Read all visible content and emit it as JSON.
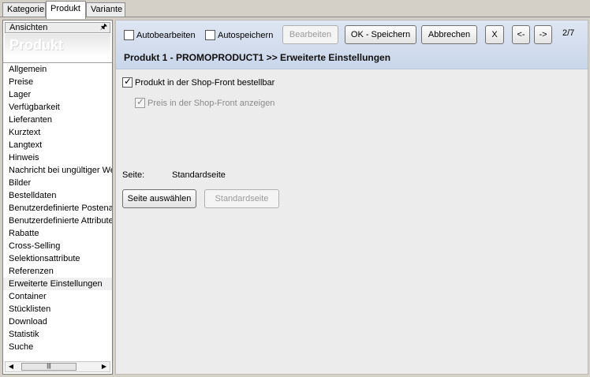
{
  "tabs": [
    {
      "label": "Kategorie"
    },
    {
      "label": "Produkt"
    },
    {
      "label": "Variante"
    }
  ],
  "left_panel": {
    "header": "Ansichten",
    "banner": "Produkt",
    "items": [
      {
        "label": "Allgemein"
      },
      {
        "label": "Preise"
      },
      {
        "label": "Lager"
      },
      {
        "label": "Verfügbarkeit"
      },
      {
        "label": "Lieferanten"
      },
      {
        "label": "Kurztext"
      },
      {
        "label": "Langtext"
      },
      {
        "label": "Hinweis"
      },
      {
        "label": "Nachricht bei ungültiger We"
      },
      {
        "label": "Bilder"
      },
      {
        "label": "Bestelldaten"
      },
      {
        "label": "Benutzerdefinierte Postenat"
      },
      {
        "label": "Benutzerdefinierte Attribute"
      },
      {
        "label": "Rabatte"
      },
      {
        "label": "Cross-Selling"
      },
      {
        "label": "Selektionsattribute"
      },
      {
        "label": "Referenzen"
      },
      {
        "label": "Erweiterte Einstellungen"
      },
      {
        "label": "Container"
      },
      {
        "label": "Stücklisten"
      },
      {
        "label": "Download"
      },
      {
        "label": "Statistik"
      },
      {
        "label": "Suche"
      }
    ],
    "selected": "Erweiterte Einstellungen"
  },
  "toolbar": {
    "autobearbeiten": "Autobearbeiten",
    "autospeichern": "Autospeichern",
    "bearbeiten": "Bearbeiten",
    "ok_speichern": "OK - Speichern",
    "abbrechen": "Abbrechen",
    "close": "X",
    "prev": "<-",
    "next": "->",
    "counter": "2/7",
    "title": "Produkt 1 - PROMOPRODUCT1 >> Erweiterte Einstellungen"
  },
  "content": {
    "orderable_label": "Produkt in der Shop-Front bestellbar",
    "show_price_label": "Preis in der Shop-Front anzeigen",
    "seite_label": "Seite:",
    "seite_value": "Standardseite",
    "seite_select_button": "Seite auswählen",
    "standardseite_button": "Standardseite"
  }
}
